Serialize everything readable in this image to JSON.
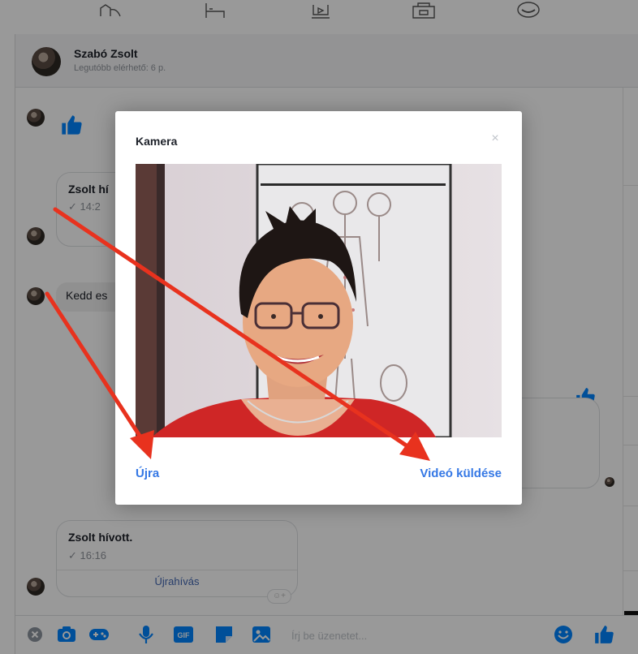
{
  "top_icons": [
    "playground-icon",
    "bed-icon",
    "tv-icon",
    "storage-icon",
    "bowl-icon"
  ],
  "header": {
    "name": "Szabó Zsolt",
    "status": "Legutóbb elérhető: 6 p."
  },
  "thread": {
    "call_1": {
      "title": "Zsolt hí",
      "time": "✓ 14:2"
    },
    "text_bubble": "Kedd es",
    "call_2": {
      "title": "Zsolt hívott.",
      "time": "✓ 16:16",
      "button": "Újrahívás"
    },
    "reaction_pill": "☺+"
  },
  "composer": {
    "placeholder": "Írj be üzenetet...",
    "gif_label": "GIF",
    "icons": [
      "close-icon",
      "camera-icon",
      "game-icon",
      "microphone-icon",
      "gif-icon",
      "sticker-icon",
      "image-icon",
      "emoji-icon",
      "like-icon"
    ]
  },
  "modal": {
    "title": "Kamera",
    "close_glyph": "×",
    "retry_label": "Újra",
    "send_label": "Videó küldése"
  },
  "colors": {
    "accent": "#3578e5",
    "messenger_blue": "#0084ff",
    "arrow_red": "#e8321e"
  }
}
